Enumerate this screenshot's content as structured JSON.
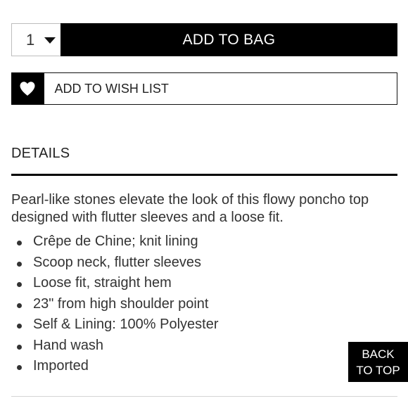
{
  "purchase": {
    "quantity": "1",
    "add_to_bag_label": "ADD TO BAG"
  },
  "wishlist": {
    "label": "ADD TO WISH LIST",
    "icon": "heart-icon"
  },
  "details": {
    "heading": "DETAILS",
    "description": "Pearl-like stones elevate the look of this flowy poncho top designed with flutter sleeves and a loose fit.",
    "bullets": [
      "Crêpe de Chine; knit lining",
      "Scoop neck, flutter sleeves",
      "Loose fit, straight hem",
      "23\" from high shoulder point",
      "Self & Lining: 100% Polyester",
      "Hand wash",
      "Imported"
    ]
  },
  "back_to_top": {
    "line1": "BACK",
    "line2": "TO TOP"
  },
  "colors": {
    "primary": "#000000",
    "text": "#333333",
    "background": "#ffffff"
  }
}
